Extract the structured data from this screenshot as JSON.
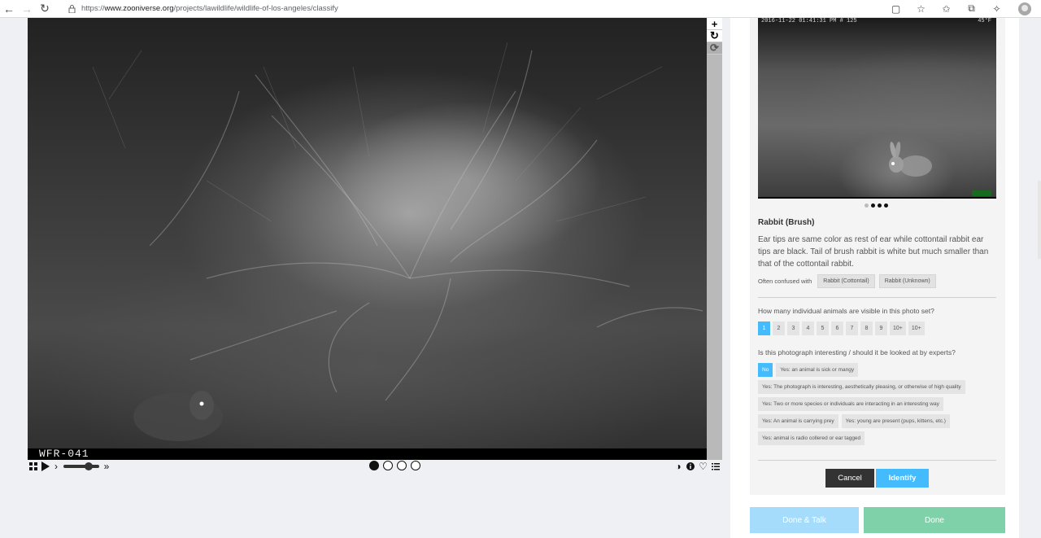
{
  "browser": {
    "url_prefix": "https://",
    "url_domain": "www.zooniverse.org",
    "url_path": "/projects/lawildlife/wildlife-of-los-angeles/classify"
  },
  "viewer": {
    "camera_label": "WFR-041",
    "frames": 4,
    "active_frame": 1,
    "zoom_controls": [
      "+",
      "↻",
      "⟳"
    ]
  },
  "reference": {
    "stamp_left": "2016-11-22 01:41:31 PM   # 125",
    "stamp_right": "45°F",
    "pager_dots": 4,
    "active_dot": 1
  },
  "species": {
    "title": "Rabbit (Brush)",
    "description": "Ear tips are same color as rest of ear while cottontail rabbit ear tips are black. Tail of brush rabbit is white but much smaller than that of the cottontail rabbit.",
    "confused_label": "Often confused with",
    "confused_with": [
      "Rabbit (Cottontail)",
      "Rabbit (Unknown)"
    ]
  },
  "question_count": {
    "prompt": "How many individual animals are visible in this photo set?",
    "options": [
      "1",
      "2",
      "3",
      "4",
      "5",
      "6",
      "7",
      "8",
      "9",
      "10+",
      "10+"
    ],
    "selected_index": 0
  },
  "question_interesting": {
    "prompt": "Is this photograph interesting / should it be looked at by experts?",
    "options": [
      "No",
      "Yes: an animal is sick or mangy",
      "Yes: The photograph is interesting, aesthetically pleasing, or otherwise of high quality",
      "Yes: Two or more species or individuals are interacting in an interesting way",
      "Yes: An animal is carrying prey",
      "Yes: young are present (pups, kittens, etc.)",
      "Yes: animal is radio collered or ear tagged"
    ],
    "selected_index": 0
  },
  "buttons": {
    "cancel": "Cancel",
    "identify": "Identify",
    "done_talk": "Done & Talk",
    "done": "Done"
  },
  "colors": {
    "accent_blue": "#43bbfd",
    "done_green": "#7fd1aa",
    "done_talk_blue": "#a6dcfb",
    "cancel_dark": "#333333"
  }
}
